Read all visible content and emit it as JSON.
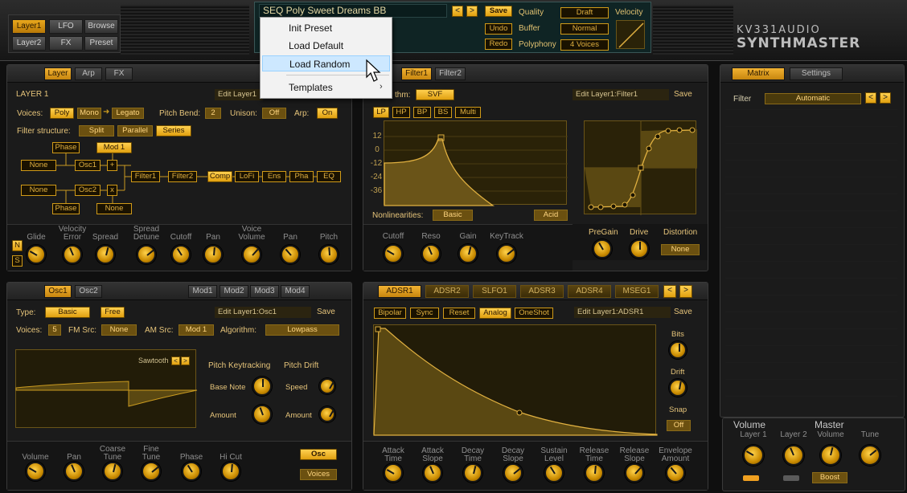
{
  "top": {
    "nav": [
      "Layer1",
      "LFO",
      "Browse",
      "Layer2",
      "FX",
      "Preset"
    ],
    "preset_name": "SEQ Poly Sweet Dreams BB",
    "save": "Save",
    "undo": "Undo",
    "redo": "Redo",
    "quality_label": "Quality",
    "quality_value": "Draft",
    "buffer_label": "Buffer",
    "buffer_value": "Normal",
    "polyphony_label": "Polyphony",
    "polyphony_value": "4 Voices",
    "velocity_label": "Velocity",
    "brand_top": "KV331AUDIO",
    "brand_bottom": "SYNTHMASTER"
  },
  "menu": {
    "items": [
      "Init Preset",
      "Load Default",
      "Load Random",
      "Templates"
    ],
    "highlighted": "Load Random"
  },
  "layer": {
    "tabs": [
      "Layer",
      "Arp",
      "FX"
    ],
    "title": "LAYER 1",
    "edit": "Edit Layer1",
    "voices_label": "Voices:",
    "voices": [
      "Poly",
      "Mono",
      "Legato"
    ],
    "pitch_bend_label": "Pitch Bend:",
    "pitch_bend": "2",
    "unison_label": "Unison:",
    "unison": "Off",
    "arp_label": "Arp:",
    "arp": "On",
    "filter_structure_label": "Filter structure:",
    "structures": [
      "Split",
      "Parallel",
      "Series"
    ],
    "routing": {
      "phase1": "Phase",
      "mod1": "Mod 1",
      "none1": "None",
      "osc1": "Osc1",
      "plus": "+",
      "filter1": "Filter1",
      "filter2": "Filter2",
      "comp": "Comp",
      "lofi": "LoFi",
      "ens": "Ens",
      "pha": "Pha",
      "eq": "EQ",
      "none2": "None",
      "osc2": "Osc2",
      "x": "x",
      "phase2": "Phase",
      "none3": "None"
    },
    "side": [
      "N",
      "S"
    ],
    "knobs": [
      "Glide",
      "Velocity\nError",
      "Spread",
      "Spread\nDetune",
      "Cutoff",
      "Pan",
      "Voice\nVolume",
      "Pan",
      "Pitch"
    ]
  },
  "filter": {
    "tabs": [
      "Filter1",
      "Filter2"
    ],
    "algo_label": "thm:",
    "algo": "SVF",
    "edit": "Edit Layer1:Filter1",
    "save": "Save",
    "modes": [
      "LP",
      "HP",
      "BP",
      "BS",
      "Multi"
    ],
    "yticks": [
      "12",
      "0",
      "-12",
      "-24",
      "-36"
    ],
    "nonlin_label": "Nonlinearities:",
    "nonlin": "Basic",
    "nonlin2": "Acid",
    "knobs": [
      "Cutoff",
      "Reso",
      "Gain",
      "KeyTrack"
    ],
    "dist_labels": [
      "PreGain",
      "Drive",
      "Distortion"
    ],
    "dist_value": "None"
  },
  "matrix": {
    "tabs": [
      "Matrix",
      "Settings"
    ],
    "filter_label": "Filter",
    "filter_value": "Automatic",
    "volume_label": "Volume",
    "master_label": "Master",
    "knobs": [
      "Layer 1",
      "Layer 2",
      "Volume",
      "Tune"
    ],
    "boost": "Boost"
  },
  "osc": {
    "tabs": [
      "Osc1",
      "Osc2"
    ],
    "mod_tabs": [
      "Mod1",
      "Mod2",
      "Mod3",
      "Mod4"
    ],
    "type_label": "Type:",
    "type": "Basic",
    "free": "Free",
    "edit": "Edit Layer1:Osc1",
    "save": "Save",
    "voices_label": "Voices:",
    "voices": "5",
    "fm_label": "FM Src:",
    "fm": "None",
    "am_label": "AM Src:",
    "am": "Mod 1",
    "algo_label": "Algorithm:",
    "algo": "Lowpass",
    "wave": "Sawtooth",
    "pk_label": "Pitch Keytracking",
    "pd_label": "Pitch Drift",
    "base_note": "Base Note",
    "speed": "Speed",
    "amount": "Amount",
    "knobs": [
      "Volume",
      "Pan",
      "Coarse\nTune",
      "Fine\nTune",
      "Phase",
      "Hi Cut"
    ],
    "osc_btn": "Osc",
    "voices_btn": "Voices"
  },
  "env": {
    "tabs": [
      "ADSR1",
      "ADSR2",
      "SLFO1",
      "ADSR3",
      "ADSR4",
      "MSEG1"
    ],
    "options": [
      "Bipolar",
      "Sync",
      "Reset",
      "Analog",
      "OneShot"
    ],
    "edit": "Edit Layer1:ADSR1",
    "save": "Save",
    "bits": "Bits",
    "drift": "Drift",
    "snap": "Snap",
    "snap_value": "Off",
    "knobs": [
      "Attack\nTime",
      "Attack\nSlope",
      "Decay\nTime",
      "Decay\nSlope",
      "Sustain\nLevel",
      "Release\nTime",
      "Release\nSlope",
      "Envelope\nAmount"
    ]
  }
}
